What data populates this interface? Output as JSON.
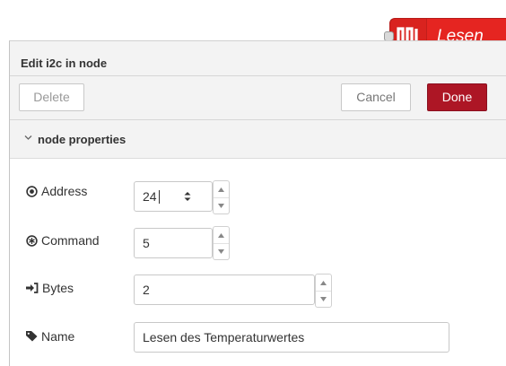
{
  "node_badge": {
    "label": "Lesen",
    "color": "#e52521"
  },
  "tray": {
    "title": "Edit i2c in node"
  },
  "toolbar": {
    "delete_label": "Delete",
    "cancel_label": "Cancel",
    "done_label": "Done"
  },
  "section": {
    "label": "node properties"
  },
  "fields": {
    "address": {
      "label": "Address",
      "value": "24"
    },
    "command": {
      "label": "Command",
      "value": "5"
    },
    "bytes": {
      "label": "Bytes",
      "value": "2"
    },
    "name": {
      "label": "Name",
      "value": "Lesen des Temperaturwertes"
    }
  },
  "icons": {
    "address": "dot-circle-icon",
    "command": "asterisk-circle-icon",
    "bytes": "sign-in-icon",
    "name": "tag-icon",
    "node": "square-wave-icon"
  },
  "colors": {
    "accent": "#ad1625",
    "node": "#e52521"
  }
}
